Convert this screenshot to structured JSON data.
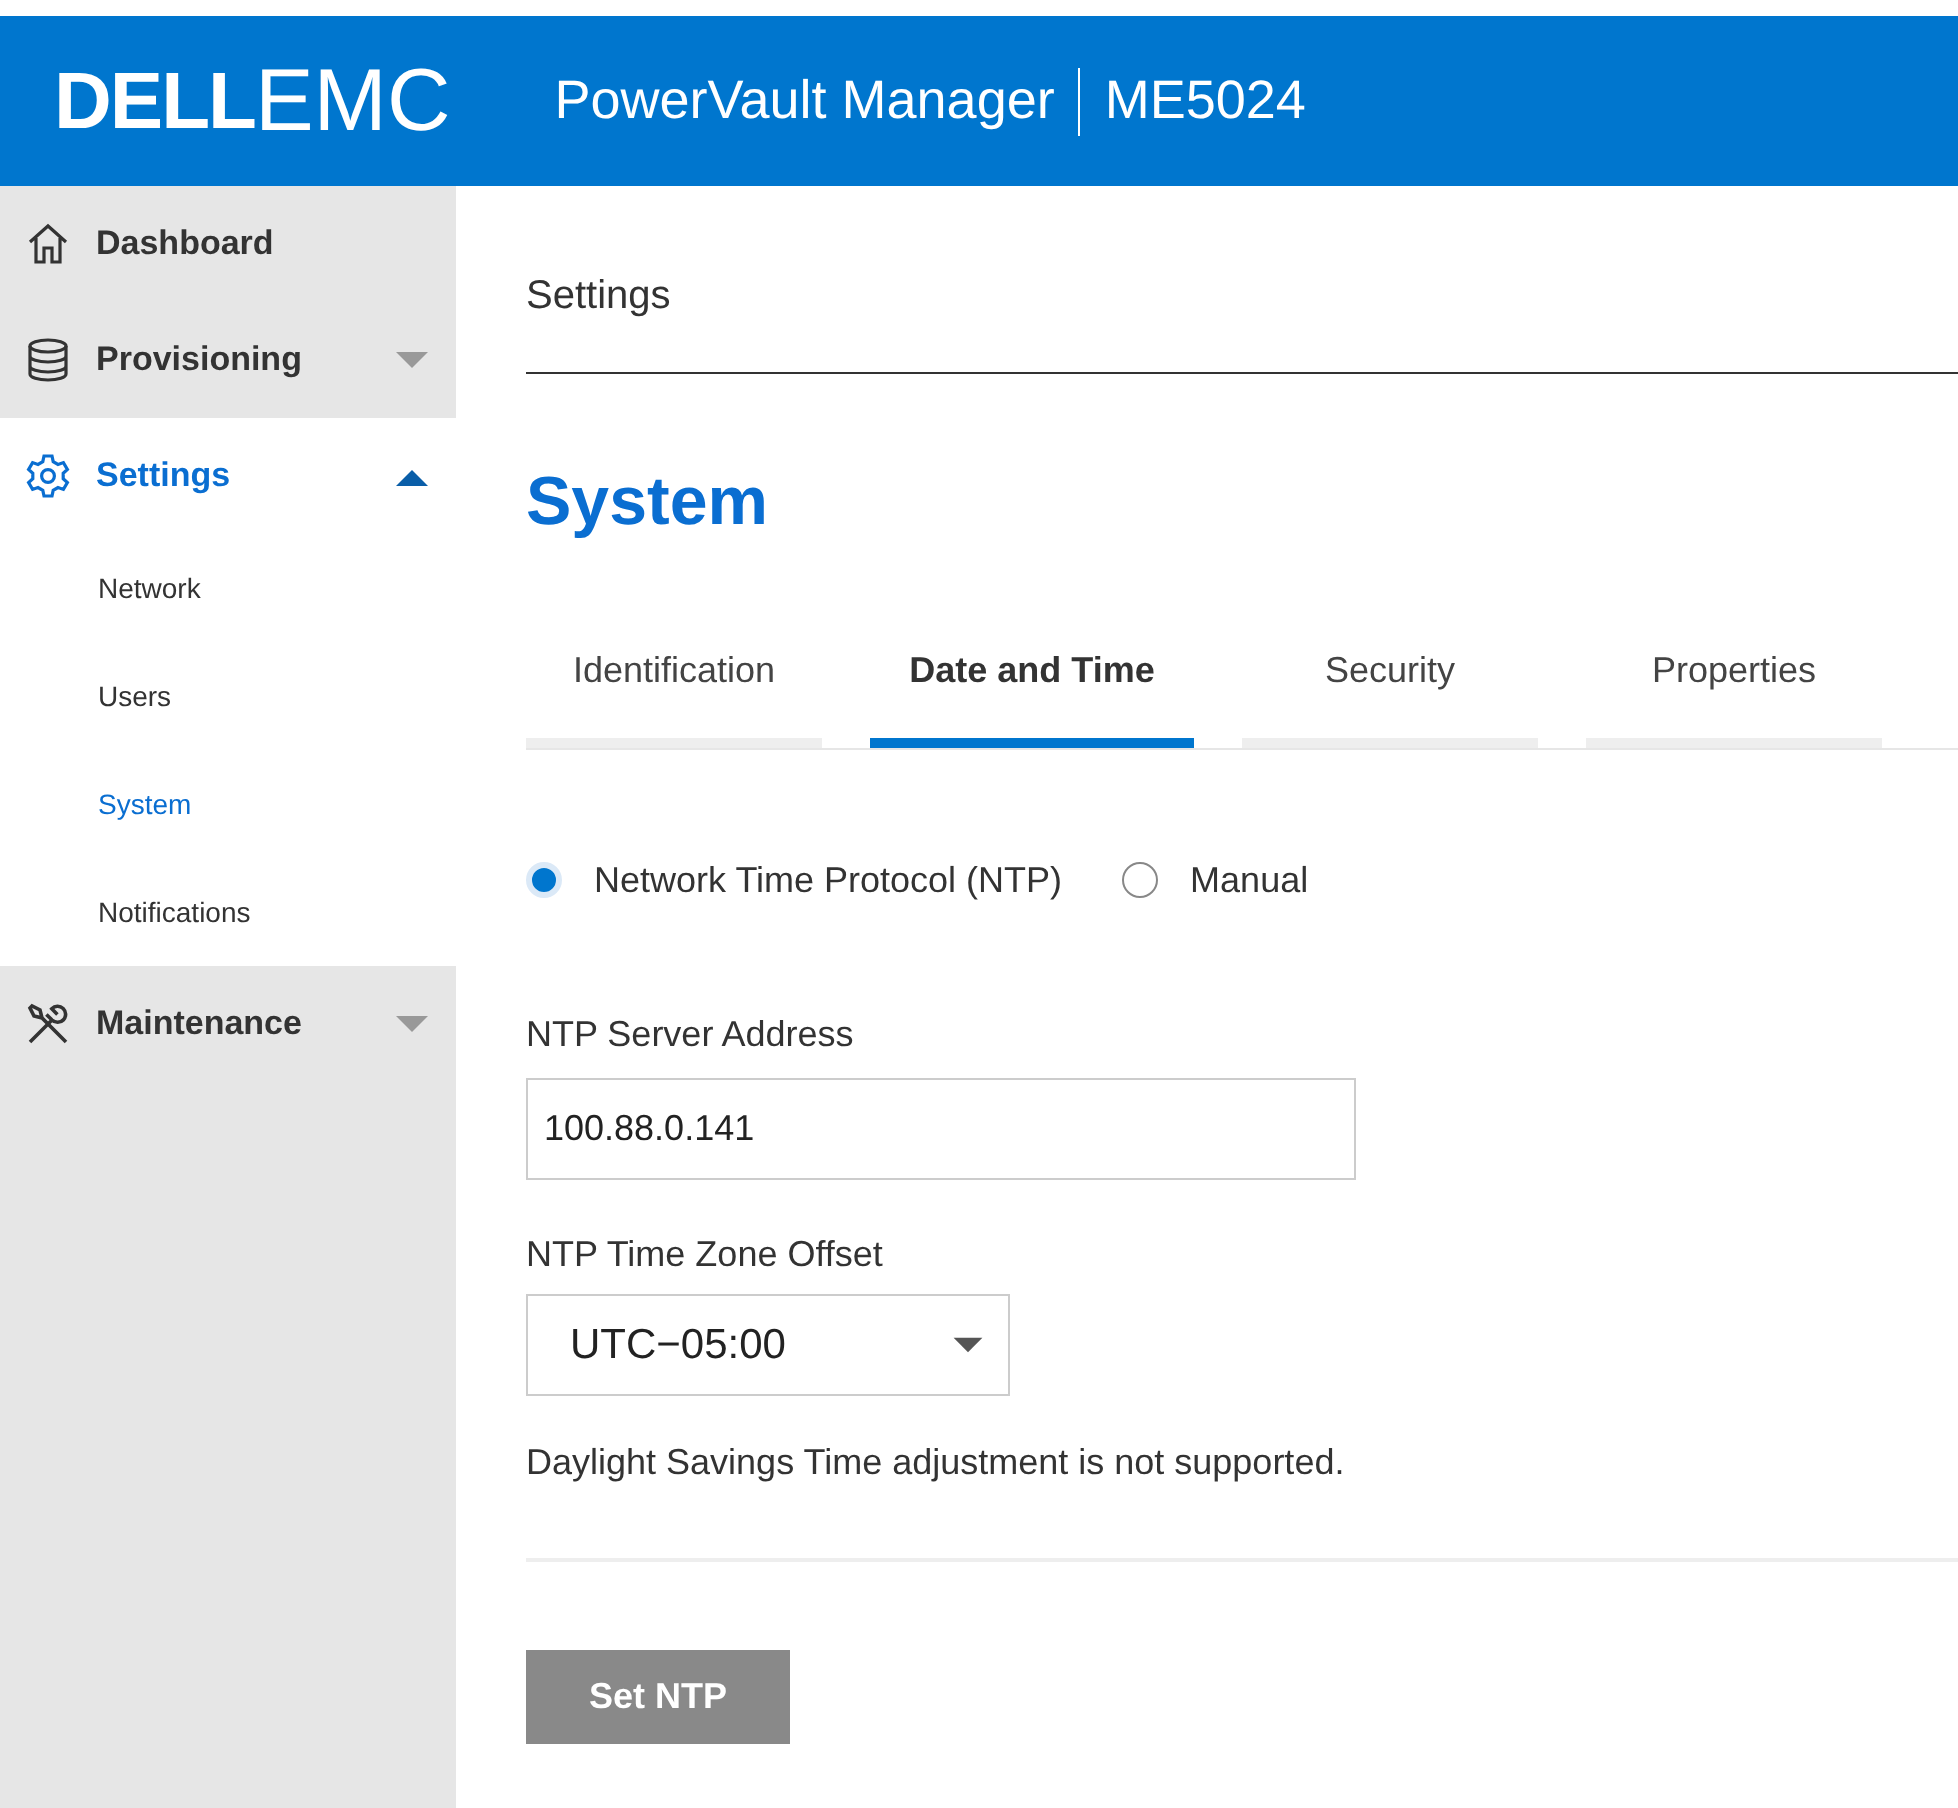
{
  "header": {
    "logo_dell": "DELL",
    "logo_emc": "EMC",
    "app_title": "PowerVault Manager",
    "model": "ME5024"
  },
  "sidebar": {
    "items": [
      {
        "label": "Dashboard",
        "selected": false
      },
      {
        "label": "Provisioning",
        "expanded": false,
        "selected": false
      },
      {
        "label": "Settings",
        "expanded": true,
        "selected": true,
        "children": [
          {
            "label": "Network",
            "selected": false
          },
          {
            "label": "Users",
            "selected": false
          },
          {
            "label": "System",
            "selected": true
          },
          {
            "label": "Notifications",
            "selected": false
          }
        ]
      },
      {
        "label": "Maintenance",
        "expanded": false,
        "selected": false
      }
    ]
  },
  "breadcrumb": "Settings",
  "page_title": "System",
  "tabs": [
    {
      "label": "Identification",
      "selected": false
    },
    {
      "label": "Date and Time",
      "selected": true
    },
    {
      "label": "Security",
      "selected": false
    },
    {
      "label": "Properties",
      "selected": false
    }
  ],
  "time_source": [
    {
      "label": "Network Time Protocol (NTP)",
      "selected": true
    },
    {
      "label": "Manual",
      "selected": false
    }
  ],
  "ntp_server": {
    "label": "NTP Server Address",
    "value": "100.88.0.141"
  },
  "time_zone": {
    "label": "NTP Time Zone Offset",
    "value": "UTC−05:00"
  },
  "note": "Daylight Savings Time adjustment is not supported.",
  "button": "Set NTP"
}
